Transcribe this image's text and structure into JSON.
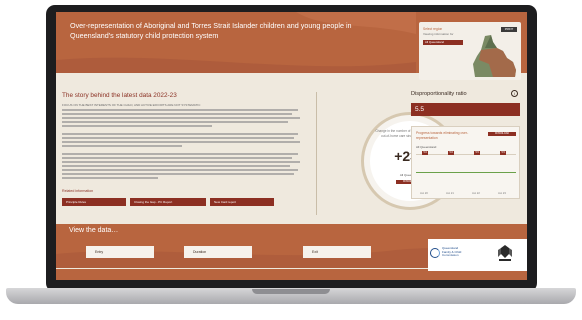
{
  "hero": {
    "title": "Over-representation of Aboriginal and Torres Strait Islander children and young people in Queensland's statutory child protection system"
  },
  "map_card": {
    "select_label": "Select region",
    "sub_label": "Viewing information for",
    "selected_region": "All Queensland",
    "print_label": "PRINT"
  },
  "story": {
    "title": "The story behind the latest data 2022-23",
    "focus": "FOCUS ON THE BEST INTERESTS OF THE CHILD, AND ACTIVE EFFORTS ARE NOT SYSTEMATIC",
    "related_label": "Related information",
    "related_buttons": [
      "Principle Rules",
      "Closing the Gap - PC Report",
      "New Card report"
    ]
  },
  "change": {
    "label": "Change in the number of First Nations children in out-of-home care since the previous year",
    "value": "+232",
    "region": "All Queensland",
    "button": "DOWNLOAD"
  },
  "ratio": {
    "title": "Disproportionality ratio",
    "value": "5.5"
  },
  "progress": {
    "title": "Progress towards eliminating over-representation",
    "button": "DOWNLOAD",
    "region": "All Queensland",
    "points": [
      "5.6",
      "5.6",
      "5.5",
      "5.5"
    ],
    "years": [
      "Jun 20",
      "Jun 21",
      "Jun 22",
      "Jun 23"
    ]
  },
  "view": {
    "title": "View the data…",
    "fields": [
      "Entry",
      "Duration",
      "Exit"
    ]
  },
  "logo": {
    "org_line1": "Queensland",
    "org_line2": "Family & Child",
    "org_line3": "Commission"
  },
  "colors": {
    "brand": "#b8653f",
    "accent": "#8c2f22",
    "target": "#6ba14a"
  }
}
